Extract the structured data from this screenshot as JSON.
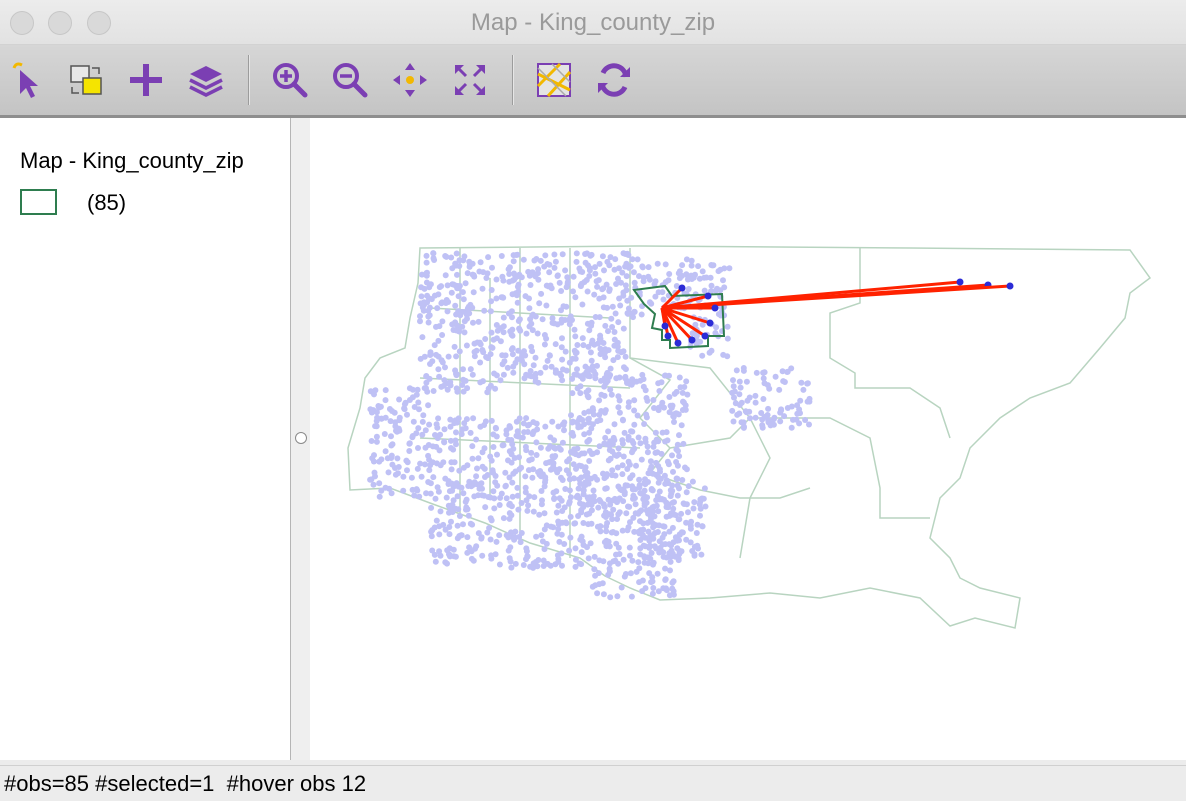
{
  "window": {
    "title": "Map - King_county_zip"
  },
  "toolbar": {
    "tools": [
      {
        "name": "select-tool",
        "icon": "pointer-arrow-icon"
      },
      {
        "name": "selection-shape-tool",
        "icon": "selection-shape-icon"
      },
      {
        "name": "add-layer-tool",
        "icon": "plus-icon"
      },
      {
        "name": "layers-tool",
        "icon": "layers-icon"
      },
      {
        "name": "zoom-in-tool",
        "icon": "zoom-in-icon"
      },
      {
        "name": "zoom-out-tool",
        "icon": "zoom-out-icon"
      },
      {
        "name": "pan-tool",
        "icon": "pan-arrows-icon"
      },
      {
        "name": "full-extent-tool",
        "icon": "full-extent-icon"
      },
      {
        "name": "basemap-tool",
        "icon": "basemap-icon"
      },
      {
        "name": "refresh-tool",
        "icon": "refresh-icon"
      }
    ],
    "accent": "#7b3fb3"
  },
  "legend": {
    "title": "Map - King_county_zip",
    "items": [
      {
        "label": "(85)",
        "outline_color": "#2e7d4f"
      }
    ]
  },
  "map": {
    "boundary_color": "#b8d4c0",
    "selected_outline_color": "#2e7d4f",
    "point_color": "#bfc1f5",
    "selected_point_color": "#2b2bd6",
    "link_color": "#ff2200"
  },
  "status": {
    "text": "#obs=85 #selected=1  #hover obs 12"
  }
}
